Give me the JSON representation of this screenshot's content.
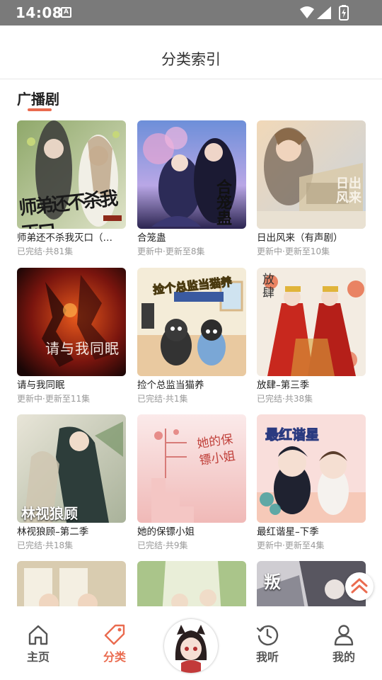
{
  "status_bar": {
    "time": "14:08",
    "notification_icon": "A"
  },
  "header": {
    "title": "分类索引"
  },
  "section": {
    "title": "广播剧"
  },
  "items": [
    {
      "title": "师弟还不杀我灭口（…",
      "status": "已完结·共81集",
      "cover_text": "师弟还不杀我灭口"
    },
    {
      "title": "合笼蛊",
      "status": "更新中·更新至8集",
      "cover_text": "合笼蛊"
    },
    {
      "title": "日出风来（有声剧）",
      "status": "更新中·更新至10集",
      "cover_text": "日出风来"
    },
    {
      "title": "请与我同眠",
      "status": "更新中·更新至11集",
      "cover_text": "请与我同眠"
    },
    {
      "title": "捡个总监当猫养",
      "status": "已完结·共1集",
      "cover_text": "捡个总监当猫养"
    },
    {
      "title": "放肆–第三季",
      "status": "已完结·共38集",
      "cover_text": "放肆"
    },
    {
      "title": "林视狼顾–第二季",
      "status": "已完结·共18集",
      "cover_text": "林视狼顾"
    },
    {
      "title": "她的保镖小姐",
      "status": "已完结·共9集",
      "cover_text": "她的保镖小姐"
    },
    {
      "title": "最红谐星–下季",
      "status": "更新中·更新至4集",
      "cover_text": "最红谐星"
    },
    {
      "title": "",
      "status": "",
      "cover_text": ""
    },
    {
      "title": "",
      "status": "",
      "cover_text": ""
    },
    {
      "title": "",
      "status": "",
      "cover_text": "叛"
    }
  ],
  "tabs": [
    {
      "label": "主页",
      "icon": "home-icon"
    },
    {
      "label": "分类",
      "icon": "tag-icon",
      "active": true
    },
    {
      "label": "我听",
      "icon": "clock-icon"
    },
    {
      "label": "我的",
      "icon": "person-icon"
    }
  ],
  "colors": {
    "accent": "#ea6b4f",
    "status_bar": "#7a7a7a"
  }
}
